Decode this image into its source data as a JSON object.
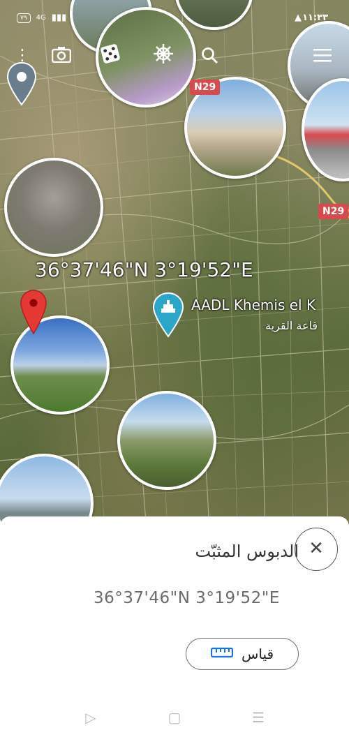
{
  "status_bar": {
    "time": "١١:٣٣",
    "battery": "٧٩",
    "network": "4G"
  },
  "toolbar": {
    "icons": [
      "menu-dots-icon",
      "camera-icon",
      "dice-icon",
      "ship-wheel-icon",
      "search-icon",
      "hamburger-menu-icon"
    ]
  },
  "map": {
    "pinned_coordinates": "36°37'46\"N 3°19'52\"E",
    "place_name": "AADL Khemis el K",
    "place_subtitle": "قاعة القرية",
    "road_labels": [
      "N29",
      "N29"
    ],
    "colors": {
      "pin_red": "#e53935",
      "poi_teal": "#2aa6c8",
      "road_sign": "#d94a4f"
    }
  },
  "bottom_sheet": {
    "title": "الدبوس المثبّت",
    "coordinates": "36°37'46\"N 3°19'52\"E",
    "measure_label": "قياس"
  },
  "nav_bar": {
    "buttons": [
      "back-icon",
      "home-icon",
      "recents-icon"
    ]
  }
}
